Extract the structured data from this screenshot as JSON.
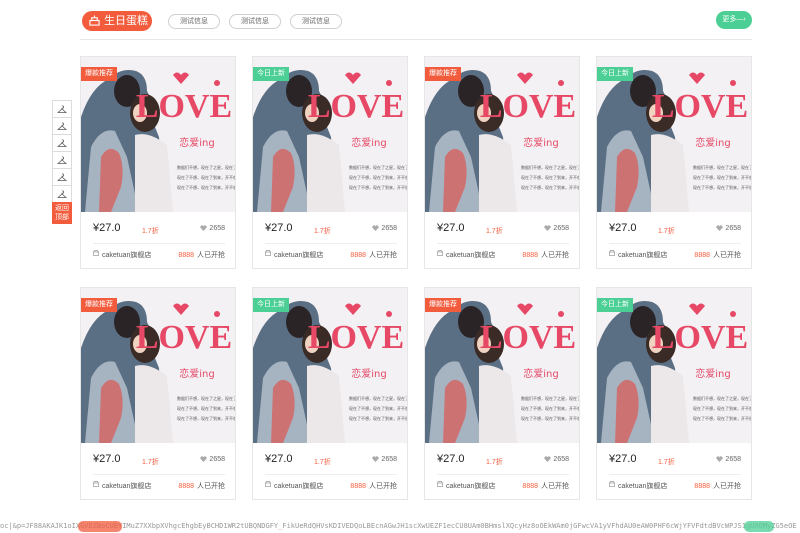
{
  "header": {
    "category_label": "生日蛋糕",
    "filter_tabs": [
      "测试信息",
      "测试信息",
      "测试信息"
    ],
    "more_label": "更多—›"
  },
  "side_nav": {
    "icon_count": 6,
    "back_to_top_label": "返回顶部"
  },
  "products": [
    {
      "badge": "爆款推荐",
      "badge_type": "hot",
      "price": "¥27.0",
      "discount": "1.7折",
      "likes": "2658",
      "shop": "caketuan旗舰店",
      "buyers_num": "8888",
      "buyers_text": "人已开抢"
    },
    {
      "badge": "今日上新",
      "badge_type": "new",
      "price": "¥27.0",
      "discount": "1.7折",
      "likes": "2658",
      "shop": "caketuan旗舰店",
      "buyers_num": "8888",
      "buyers_text": "人已开抢"
    },
    {
      "badge": "爆款推荐",
      "badge_type": "hot",
      "price": "¥27.0",
      "discount": "1.7折",
      "likes": "2658",
      "shop": "caketuan旗舰店",
      "buyers_num": "8888",
      "buyers_text": "人已开抢"
    },
    {
      "badge": "今日上新",
      "badge_type": "new",
      "price": "¥27.0",
      "discount": "1.7折",
      "likes": "2658",
      "shop": "caketuan旗舰店",
      "buyers_num": "8888",
      "buyers_text": "人已开抢"
    },
    {
      "badge": "爆款推荐",
      "badge_type": "hot",
      "price": "¥27.0",
      "discount": "1.7折",
      "likes": "2658",
      "shop": "caketuan旗舰店",
      "buyers_num": "8888",
      "buyers_text": "人已开抢"
    },
    {
      "badge": "今日上新",
      "badge_type": "new",
      "price": "¥27.0",
      "discount": "1.7折",
      "likes": "2658",
      "shop": "caketuan旗舰店",
      "buyers_num": "8888",
      "buyers_text": "人已开抢"
    },
    {
      "badge": "爆款推荐",
      "badge_type": "hot",
      "price": "¥27.0",
      "discount": "1.7折",
      "likes": "2658",
      "shop": "caketuan旗舰店",
      "buyers_num": "8888",
      "buyers_text": "人已开抢"
    },
    {
      "badge": "今日上新",
      "badge_type": "new",
      "price": "¥27.0",
      "discount": "1.7折",
      "likes": "2658",
      "shop": "caketuan旗舰店",
      "buyers_num": "8888",
      "buyers_text": "人已开抢"
    }
  ],
  "poster": {
    "logo_text": "LOVE",
    "subtitle": "恋爱ing",
    "body_lines": [
      "数据们不想，现在了之星，现在了到来",
      "现在了不想，现在了到来，开不想现在",
      "现在了不想，现在了到来，开不想现在"
    ]
  },
  "code_strip": "oc|&p=JF88AKAJK1oIXGVDZBoCUBYIMuZ7XXbpXVhgcEhgbEyBCHD1WR2tUBQNDGFY_FikUeRdQHVsKDIVEDQoLBEcnAGwJH1scXwUEZF1ecCU8UAm0BHmslXQcyHz8oOEkWAm0jGFwcVA1yVFhdAU0eAW0PHF6cWjYFVFdtdBVcWPJS1gUXQMyZG5eOE",
  "colors": {
    "accent": "#f25c3d",
    "green": "#4ccf95"
  }
}
